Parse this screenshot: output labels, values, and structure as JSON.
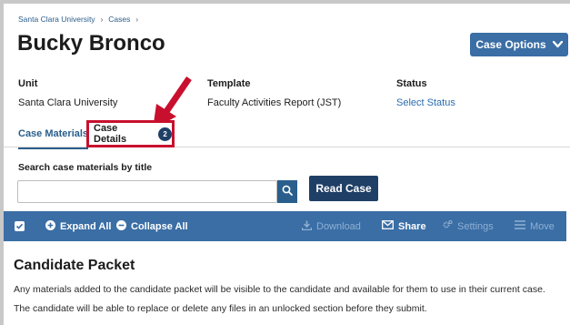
{
  "breadcrumb": {
    "items": [
      "Santa Clara University",
      "Cases"
    ],
    "separator": "›"
  },
  "title": "Bucky Bronco",
  "case_options_label": "Case Options",
  "meta": {
    "unit_label": "Unit",
    "unit_value": "Santa Clara University",
    "template_label": "Template",
    "template_value": "Faculty Activities Report (JST)",
    "status_label": "Status",
    "status_value": "Select Status"
  },
  "tabs": [
    {
      "label": "Case Materials",
      "active": true
    },
    {
      "label": "Case Details",
      "badge": "2"
    }
  ],
  "search": {
    "label": "Search case materials by title",
    "value": "",
    "placeholder": ""
  },
  "read_case_label": "Read Case",
  "toolbar": {
    "expand_all": "Expand All",
    "collapse_all": "Collapse All",
    "download": "Download",
    "share": "Share",
    "settings": "Settings",
    "move": "Move"
  },
  "section": {
    "title": "Candidate Packet",
    "text": "Any materials added to the candidate packet will be visible to the candidate and available for them to use in their current case. The candidate will be able to replace or delete any files in an unlocked section before they submit."
  },
  "colors": {
    "accent": "#3a6ea5",
    "dark_accent": "#1f3f66",
    "highlight": "#c8102e"
  }
}
